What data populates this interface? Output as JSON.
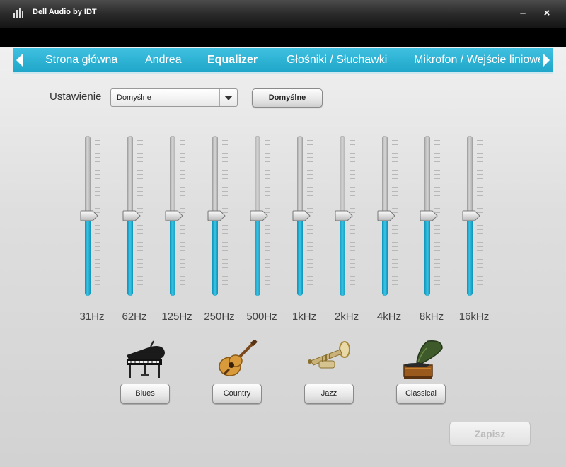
{
  "window": {
    "title": "Dell Audio by IDT",
    "minimize_label": "–",
    "close_label": "×"
  },
  "nav": {
    "tabs": [
      {
        "label": "Strona główna"
      },
      {
        "label": "Andrea"
      },
      {
        "label": "Equalizer",
        "active": true
      },
      {
        "label": "Głośniki / Słuchawki"
      },
      {
        "label": "Mikrofon / Wejście liniowe"
      }
    ]
  },
  "preset": {
    "label": "Ustawienie",
    "value": "Domyślne",
    "reset_label": "Domyślne"
  },
  "eq": {
    "bands": [
      {
        "label": "31Hz",
        "level": 0.5
      },
      {
        "label": "62Hz",
        "level": 0.5
      },
      {
        "label": "125Hz",
        "level": 0.5
      },
      {
        "label": "250Hz",
        "level": 0.5
      },
      {
        "label": "500Hz",
        "level": 0.5
      },
      {
        "label": "1kHz",
        "level": 0.5
      },
      {
        "label": "2kHz",
        "level": 0.5
      },
      {
        "label": "4kHz",
        "level": 0.5
      },
      {
        "label": "8kHz",
        "level": 0.5
      },
      {
        "label": "16kHz",
        "level": 0.5
      }
    ]
  },
  "genres": [
    {
      "label": "Blues",
      "icon": "grand-piano-icon"
    },
    {
      "label": "Country",
      "icon": "acoustic-guitar-icon"
    },
    {
      "label": "Jazz",
      "icon": "trumpet-icon"
    },
    {
      "label": "Classical",
      "icon": "gramophone-icon"
    }
  ],
  "save_label": "Zapisz",
  "colors": {
    "accent": "#1fa6c9",
    "fill": "#2bb4d8",
    "titlebar": "#1a1a1a"
  }
}
